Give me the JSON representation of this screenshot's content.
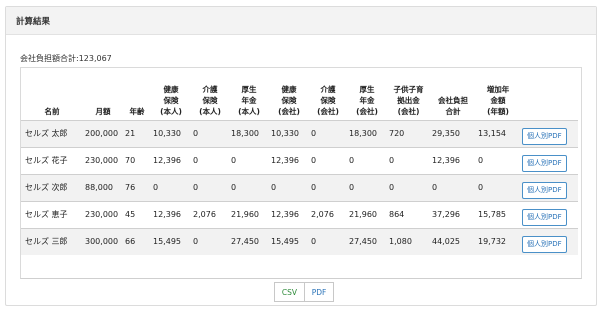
{
  "panel": {
    "title": "計算結果"
  },
  "summary": {
    "text": "会社負担額合計:123,067"
  },
  "table": {
    "headers": [
      {
        "lines": [
          "名前"
        ]
      },
      {
        "lines": [
          "月額"
        ]
      },
      {
        "lines": [
          "年齢"
        ]
      },
      {
        "lines": [
          "健康",
          "保険",
          "(本人)"
        ]
      },
      {
        "lines": [
          "介護",
          "保険",
          "(本人)"
        ]
      },
      {
        "lines": [
          "厚生",
          "年金",
          "(本人)"
        ]
      },
      {
        "lines": [
          "健康",
          "保険",
          "(会社)"
        ]
      },
      {
        "lines": [
          "介護",
          "保険",
          "(会社)"
        ]
      },
      {
        "lines": [
          "厚生",
          "年金",
          "(会社)"
        ]
      },
      {
        "lines": [
          "子供子育",
          "拠出金",
          "(会社)"
        ]
      },
      {
        "lines": [
          "会社負担",
          "合計"
        ]
      },
      {
        "lines": [
          "増加年",
          "金額",
          "(年額)"
        ]
      },
      {
        "lines": [
          ""
        ]
      }
    ],
    "rows": [
      {
        "cells": [
          "セルズ 太郎",
          "200,000",
          "21",
          "10,330",
          "0",
          "18,300",
          "10,330",
          "0",
          "18,300",
          "720",
          "29,350",
          "13,154"
        ],
        "pdf_label": "個人別PDF"
      },
      {
        "cells": [
          "セルズ 花子",
          "230,000",
          "70",
          "12,396",
          "0",
          "0",
          "12,396",
          "0",
          "0",
          "0",
          "12,396",
          "0"
        ],
        "pdf_label": "個人別PDF"
      },
      {
        "cells": [
          "セルズ 次郎",
          "88,000",
          "76",
          "0",
          "0",
          "0",
          "0",
          "0",
          "0",
          "0",
          "0",
          "0"
        ],
        "pdf_label": "個人別PDF"
      },
      {
        "cells": [
          "セルズ 恵子",
          "230,000",
          "45",
          "12,396",
          "2,076",
          "21,960",
          "12,396",
          "2,076",
          "21,960",
          "864",
          "37,296",
          "15,785"
        ],
        "pdf_label": "個人別PDF"
      },
      {
        "cells": [
          "セルズ 三郎",
          "300,000",
          "66",
          "15,495",
          "0",
          "27,450",
          "15,495",
          "0",
          "27,450",
          "1,080",
          "44,025",
          "19,732"
        ],
        "pdf_label": "個人別PDF"
      }
    ]
  },
  "actions": {
    "csv_label": "CSV",
    "pdf_label": "PDF"
  },
  "colors": {
    "csv": "#2e8b3a",
    "pdf": "#2a73b8",
    "row_stripe": "#f2f2f2",
    "header_bg": "#f3f3f3"
  }
}
